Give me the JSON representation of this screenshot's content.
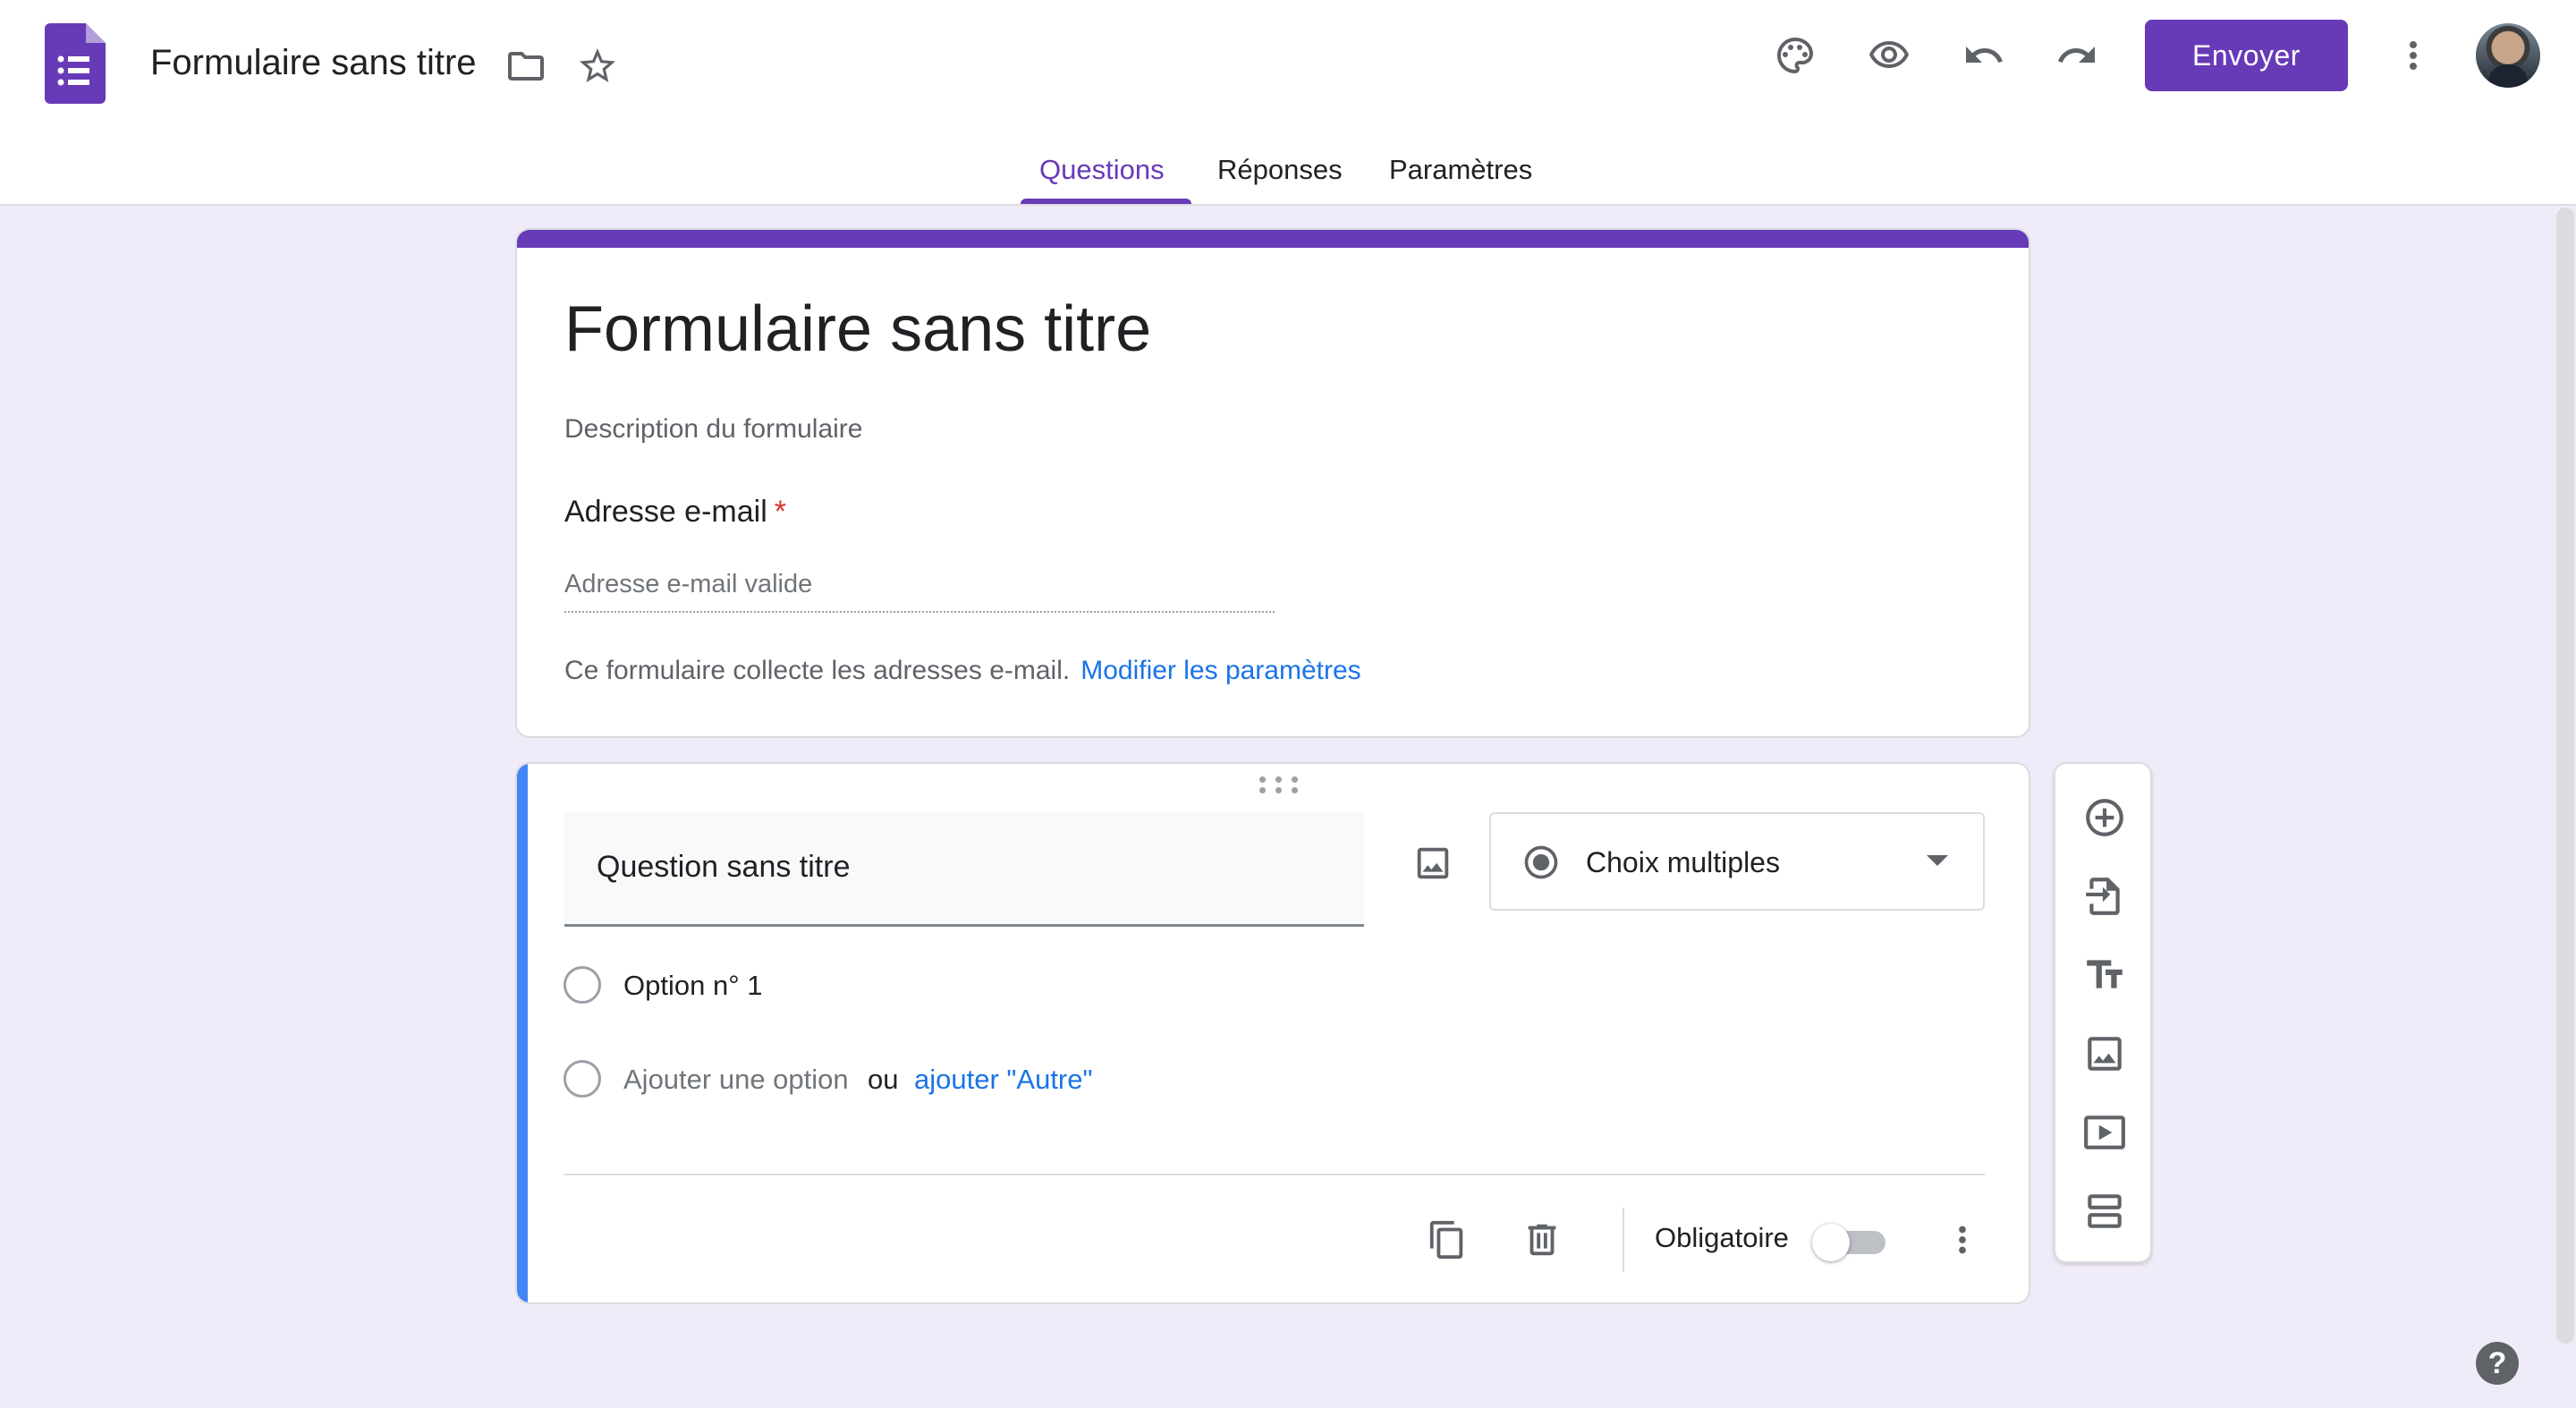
{
  "header": {
    "doc_title": "Formulaire sans titre",
    "send_label": "Envoyer",
    "icons": [
      "folder-icon",
      "star-icon",
      "palette-icon",
      "eye-icon",
      "undo-icon",
      "redo-icon",
      "more-vert-icon"
    ]
  },
  "tabs": [
    {
      "label": "Questions",
      "active": true
    },
    {
      "label": "Réponses",
      "active": false
    },
    {
      "label": "Paramètres",
      "active": false
    }
  ],
  "title_card": {
    "title": "Formulaire sans titre",
    "description_placeholder": "Description du formulaire",
    "email_label": "Adresse e-mail",
    "required_star": "*",
    "email_placeholder": "Adresse e-mail valide",
    "collect_text": "Ce formulaire collecte les adresses e-mail.",
    "collect_link": "Modifier les paramètres"
  },
  "question_card": {
    "question_text": "Question sans titre",
    "type_label": "Choix multiples",
    "option_1": "Option n° 1",
    "add_option": "Ajouter une option",
    "or_label": "ou",
    "add_other": "ajouter \"Autre\"",
    "required_label": "Obligatoire",
    "required_on": false
  },
  "side_toolbar": [
    "add-question-icon",
    "import-questions-icon",
    "add-title-icon",
    "add-image-icon",
    "add-video-icon",
    "add-section-icon"
  ],
  "colors": {
    "accent": "#673ab7",
    "background": "#f0ebf8",
    "active_card_bar": "#4285f4",
    "link": "#1a73e8",
    "required": "#d93025"
  }
}
